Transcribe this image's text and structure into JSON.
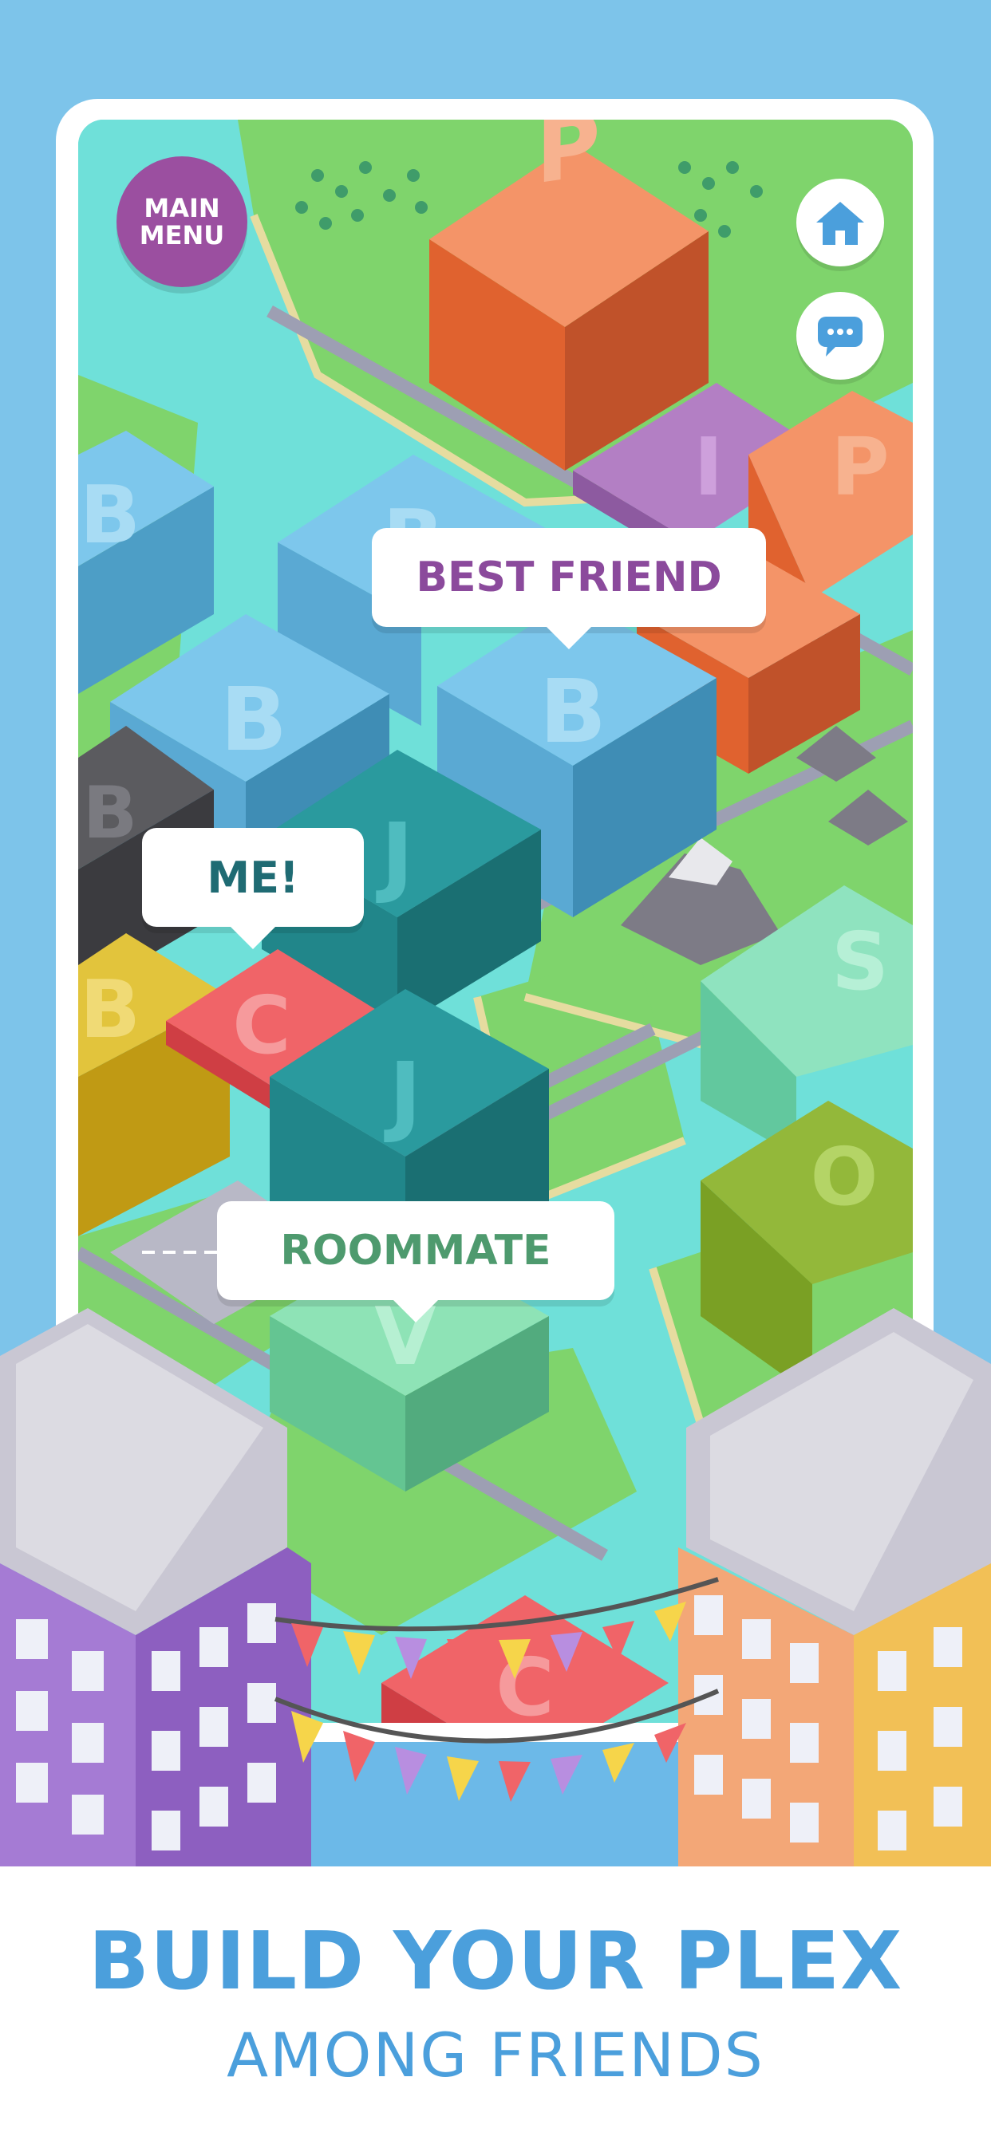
{
  "menu": {
    "line1": "MAIN",
    "line2": "MENU"
  },
  "buttons": {
    "home_icon": "home-icon",
    "chat_icon": "chat-bubble-icon"
  },
  "tiles": {
    "p1": "P",
    "i1": "I",
    "p2": "P",
    "b1": "B",
    "b2": "B",
    "b3": "B",
    "b4": "B",
    "b5": "B",
    "b6": "B",
    "j1": "J",
    "j2": "J",
    "c1": "C",
    "c2": "C",
    "s1": "S",
    "o1": "O",
    "v1": "V"
  },
  "labels": {
    "best_friend": "BEST FRIEND",
    "me": "ME!",
    "roommate": "ROOMMATE"
  },
  "caption": {
    "headline": "BUILD YOUR PLEX",
    "subline": "AMONG FRIENDS"
  },
  "colors": {
    "background": "#7dc4ea",
    "brand_blue": "#4b9fdc",
    "menu_purple": "#9b4fa0",
    "best_friend_text": "#8b4a9c",
    "me_text": "#1f6b73",
    "roommate_text": "#4e9a6e"
  }
}
